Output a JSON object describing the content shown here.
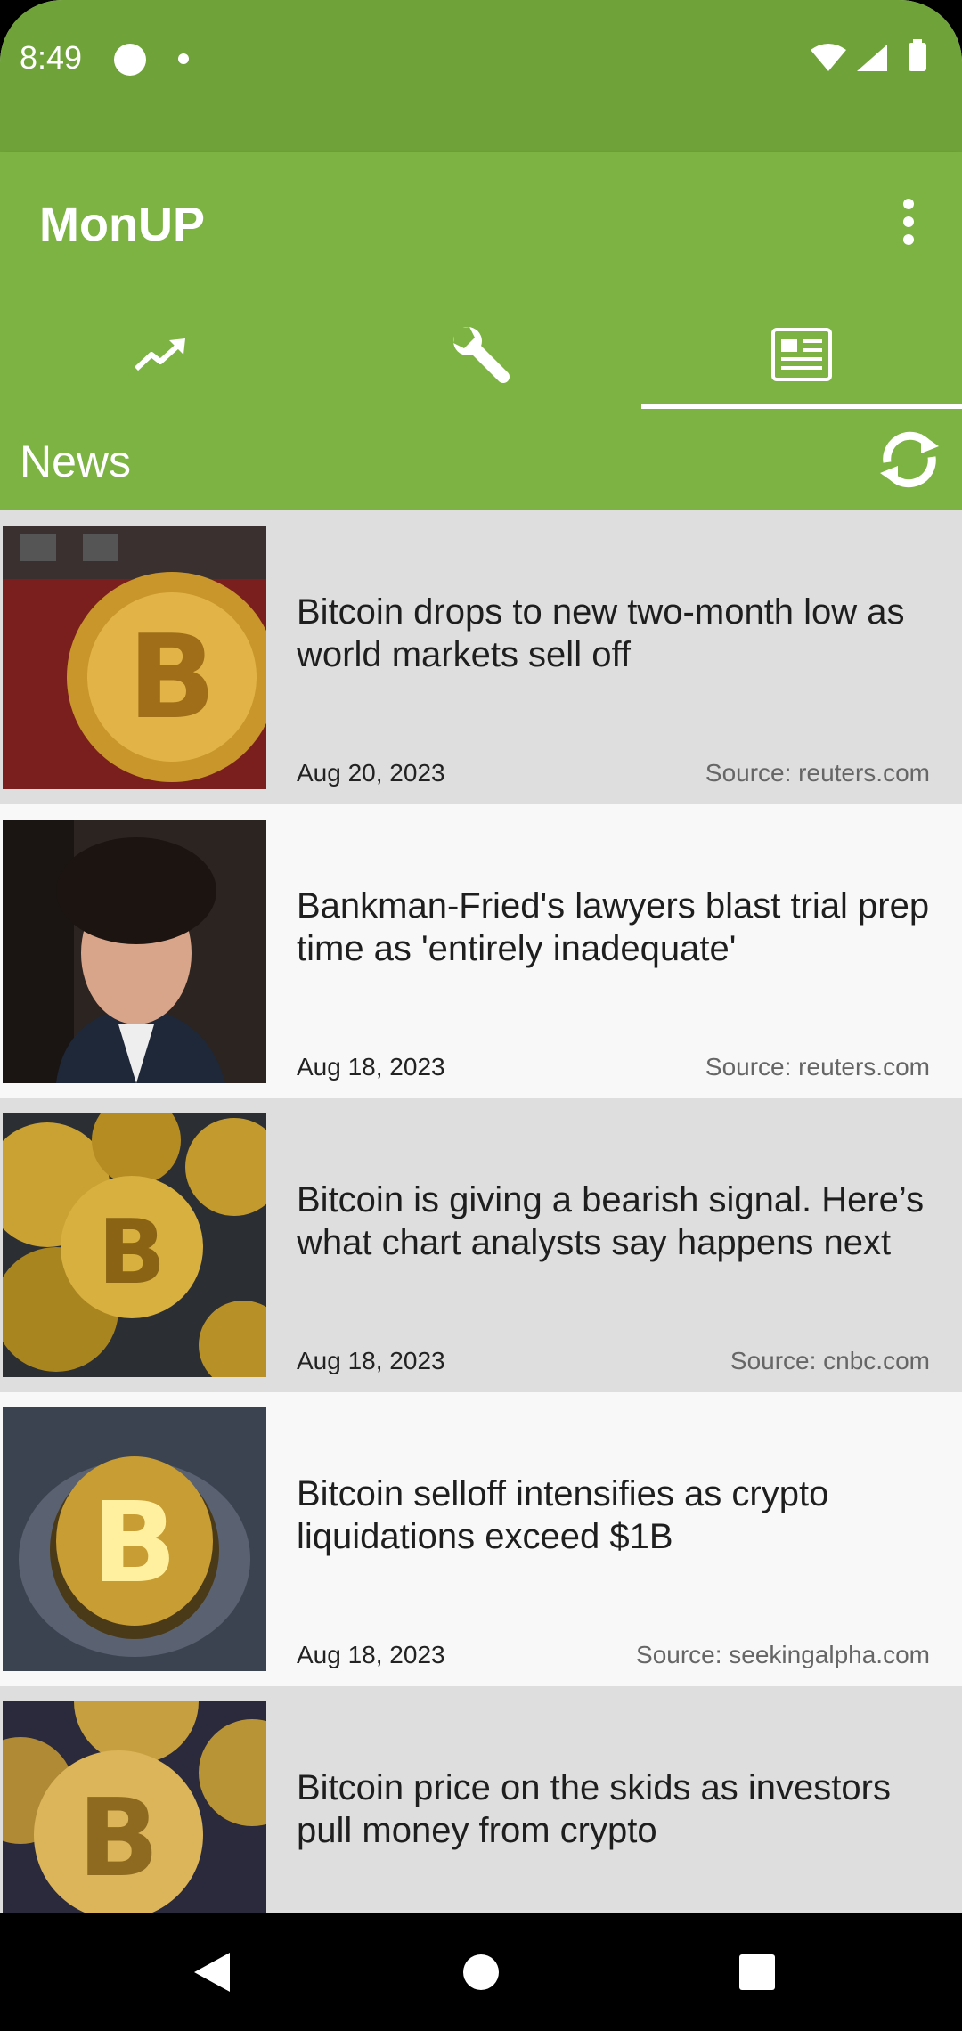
{
  "status_bar": {
    "time": "8:49"
  },
  "app": {
    "title": "MonUP"
  },
  "tabs": [
    {
      "icon": "trending-up-icon",
      "selected": false
    },
    {
      "icon": "wrench-icon",
      "selected": false
    },
    {
      "icon": "newspaper-icon",
      "selected": true
    }
  ],
  "section": {
    "title": "News"
  },
  "news": [
    {
      "headline": "Bitcoin drops to new two-month low as world markets sell off",
      "date": "Aug 20, 2023",
      "source": "Source: reuters.com"
    },
    {
      "headline": "Bankman-Fried's lawyers blast trial prep time as 'entirely inadequate'",
      "date": "Aug 18, 2023",
      "source": "Source: reuters.com"
    },
    {
      "headline": "Bitcoin is giving a bearish signal. Here’s what chart analysts say happens next",
      "date": "Aug 18, 2023",
      "source": "Source: cnbc.com"
    },
    {
      "headline": "Bitcoin selloff intensifies as crypto liquidations exceed $1B",
      "date": "Aug 18, 2023",
      "source": "Source: seekingalpha.com"
    },
    {
      "headline": "Bitcoin price on the skids as investors pull money from crypto",
      "date": "",
      "source": ""
    }
  ],
  "colors": {
    "status_bar": "#6fa33a",
    "app_bar": "#7cb342",
    "row_gray": "#dedede",
    "row_light": "#f8f8f8"
  }
}
